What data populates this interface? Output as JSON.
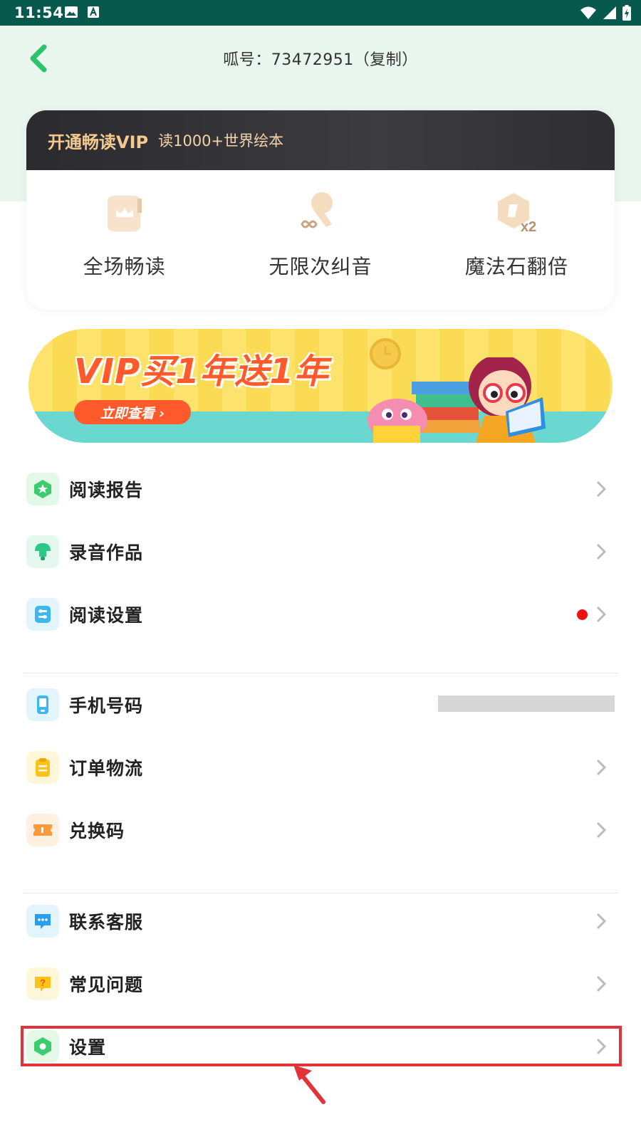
{
  "status_bar": {
    "time": "11:54",
    "icons": [
      "image-icon",
      "a-icon",
      "wifi-icon",
      "signal-icon",
      "battery-icon"
    ]
  },
  "header": {
    "account_text": "呱号：73472951（复制）",
    "back_icon": "back-chevron-icon"
  },
  "vip": {
    "title": "开通畅读VIP",
    "subtitle": "读1000+世界绘本",
    "benefits": [
      {
        "label": "全场畅读",
        "icon": "crown-book-icon"
      },
      {
        "label": "无限次纠音",
        "icon": "microphone-infinity-icon"
      },
      {
        "label": "魔法石翻倍",
        "icon": "magic-stone-x2-icon",
        "badge": "x2"
      }
    ]
  },
  "banner": {
    "title": "VIP买1年送1年",
    "button": "立即查看 ›"
  },
  "menu": {
    "items": [
      {
        "label": "阅读报告",
        "icon": "reading-report-icon"
      },
      {
        "label": "录音作品",
        "icon": "microphone-icon"
      },
      {
        "label": "阅读设置",
        "icon": "reading-settings-icon"
      },
      {
        "label": "手机号码",
        "icon": "phone-icon"
      },
      {
        "label": "订单物流",
        "icon": "order-clipboard-icon"
      },
      {
        "label": "兑换码",
        "icon": "ticket-icon"
      },
      {
        "label": "联系客服",
        "icon": "chat-bubble-icon"
      },
      {
        "label": "常见问题",
        "icon": "question-icon"
      },
      {
        "label": "设置",
        "icon": "settings-hexagon-icon"
      }
    ]
  },
  "colors": {
    "status_bar": "#06594c",
    "header_bg": "#e8f6ee",
    "accent_green": "#2dc36b",
    "vip_gold": "#f4c98f",
    "highlight_red": "#e2333a",
    "notification_red": "#ee1111"
  }
}
